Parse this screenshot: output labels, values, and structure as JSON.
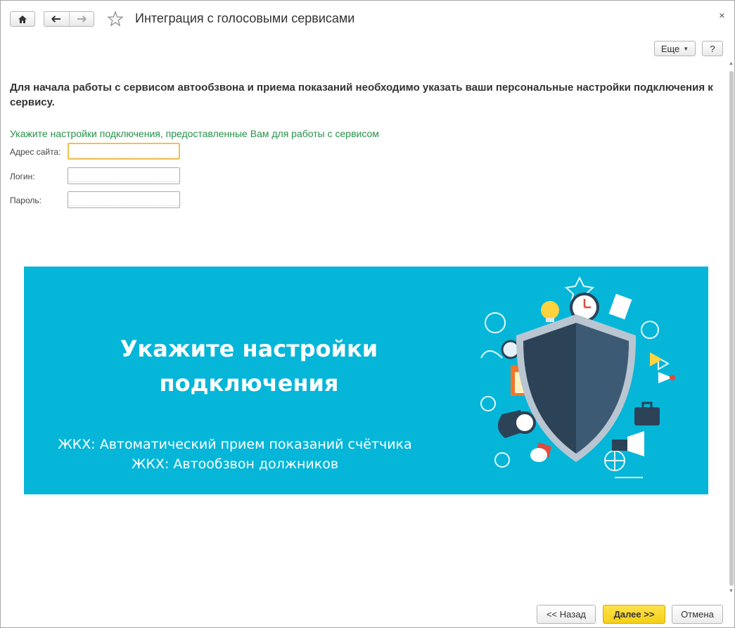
{
  "window": {
    "title": "Интеграция с голосовыми сервисами",
    "close_glyph": "×"
  },
  "toolbar": {
    "more_label": "Еще",
    "help_label": "?"
  },
  "content": {
    "intro": "Для начала работы с сервисом автообзвона и приема показаний необходимо указать ваши персональные настройки подключения к сервису.",
    "hint": "Укажите настройки подключения, предоставленные Вам для работы с сервисом",
    "fields": {
      "site_label": "Адрес сайта:",
      "site_value": "",
      "login_label": "Логин:",
      "login_value": "",
      "password_label": "Пароль:",
      "password_value": ""
    }
  },
  "banner": {
    "title_line1": "Укажите настройки",
    "title_line2": "подключения",
    "sub_line1": "ЖКХ: Автоматический прием показаний счётчика",
    "sub_line2": "ЖКХ: Автообзвон должников",
    "background_color": "#05b6d9"
  },
  "footer": {
    "back_label": "<< Назад",
    "next_label": "Далее >>",
    "cancel_label": "Отмена"
  },
  "icons": [
    "home-icon",
    "arrow-left-icon",
    "arrow-right-icon",
    "star-icon",
    "close-icon",
    "caret-down-icon",
    "shield-icon"
  ],
  "colors": {
    "accent_yellow": "#f5cf18",
    "hint_green": "#27904a",
    "focus_border": "#f2c14b"
  }
}
